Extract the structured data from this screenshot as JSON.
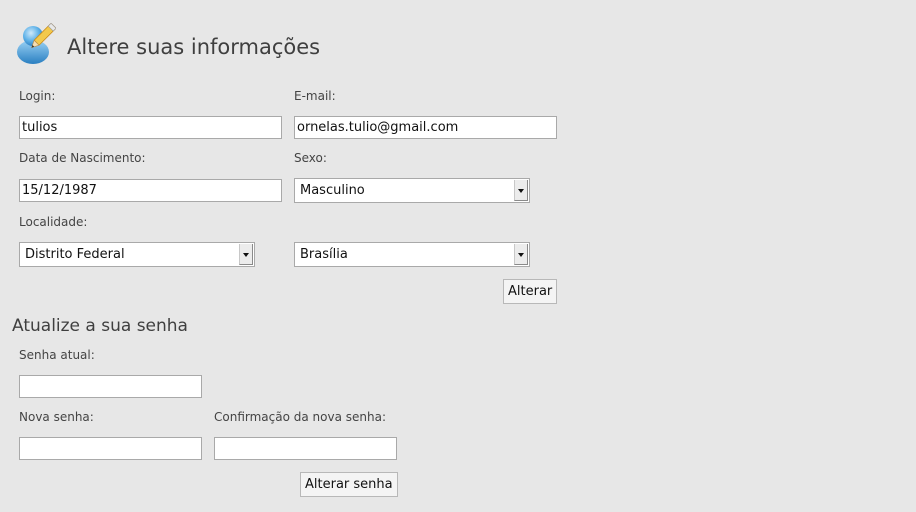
{
  "header": {
    "title": "Altere suas informações",
    "icon": "user-edit-icon"
  },
  "profile_form": {
    "login": {
      "label": "Login:",
      "value": "tulios"
    },
    "email": {
      "label": "E-mail:",
      "value": "ornelas.tulio@gmail.com"
    },
    "birth_date": {
      "label": "Data de Nascimento:",
      "value": "15/12/1987"
    },
    "gender": {
      "label": "Sexo:",
      "selected": "Masculino"
    },
    "location": {
      "label": "Localidade:",
      "state_selected": "Distrito Federal",
      "city_selected": "Brasília"
    },
    "submit_label": "Alterar"
  },
  "password_form": {
    "title": "Atualize a sua senha",
    "current": {
      "label": "Senha atual:",
      "value": ""
    },
    "new": {
      "label": "Nova senha:",
      "value": ""
    },
    "confirm": {
      "label": "Confirmação da nova senha:",
      "value": ""
    },
    "submit_label": "Alterar senha"
  }
}
